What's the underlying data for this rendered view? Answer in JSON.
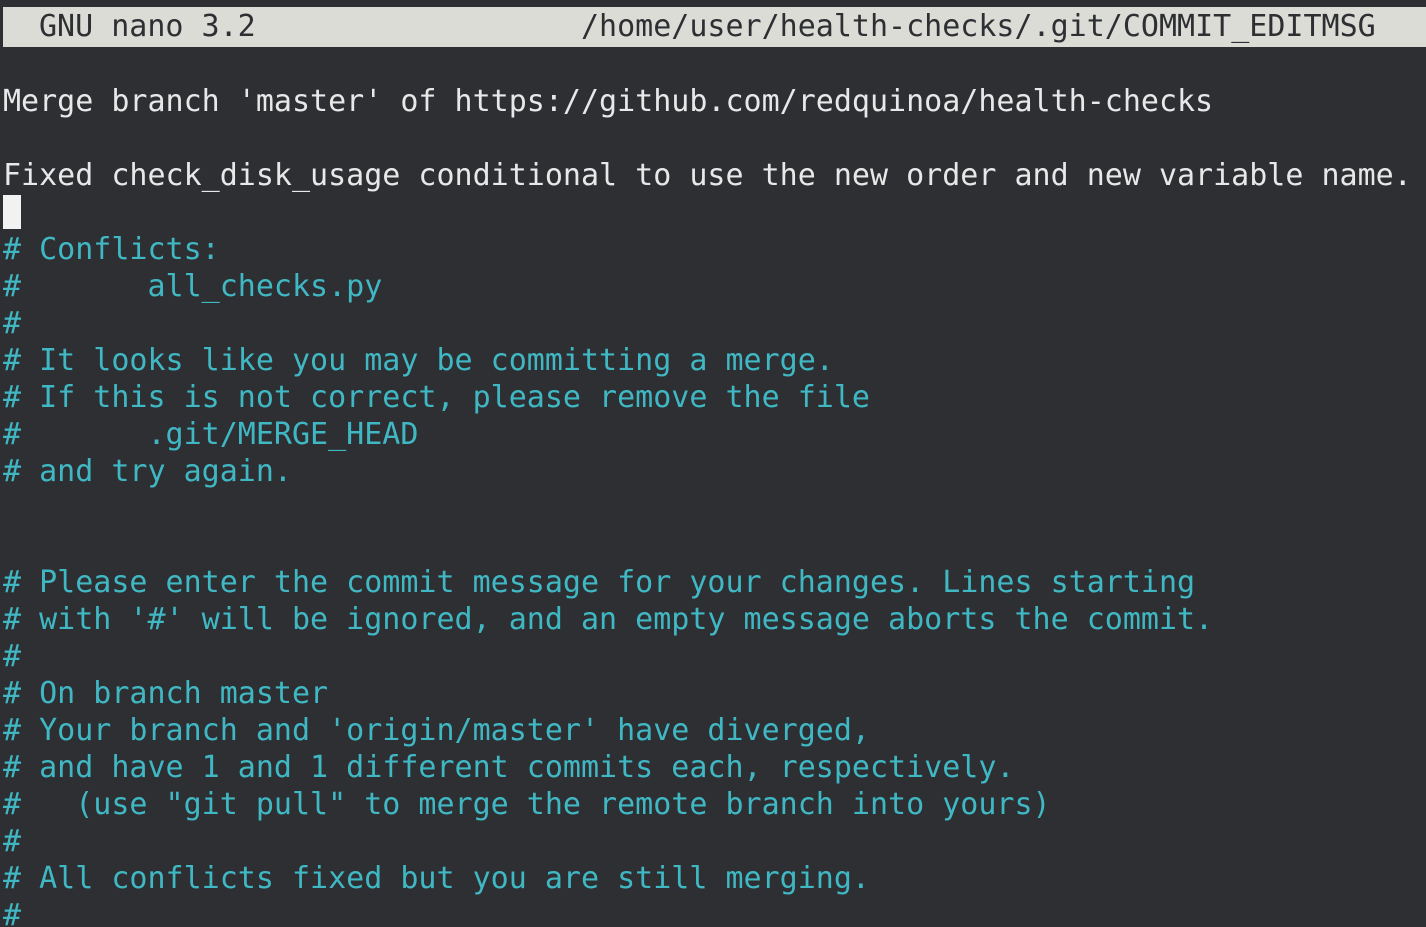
{
  "editor": {
    "name": "GNU nano 3.2",
    "file_path": "/home/user/health-checks/.git/COMMIT_EDITMSG"
  },
  "lines": [
    {
      "text": "Merge branch 'master' of https://github.com/redquinoa/health-checks",
      "kind": "plain"
    },
    {
      "text": "Fixed check_disk_usage conditional to use the new order and new variable name.",
      "kind": "plain"
    },
    {
      "text": "# Conflicts:",
      "kind": "comment"
    },
    {
      "text": "#       all_checks.py",
      "kind": "comment"
    },
    {
      "text": "#",
      "kind": "comment"
    },
    {
      "text": "# It looks like you may be committing a merge.",
      "kind": "comment"
    },
    {
      "text": "# If this is not correct, please remove the file",
      "kind": "comment"
    },
    {
      "text": "#       .git/MERGE_HEAD",
      "kind": "comment"
    },
    {
      "text": "# and try again.",
      "kind": "comment"
    },
    {
      "text": "# Please enter the commit message for your changes. Lines starting",
      "kind": "comment"
    },
    {
      "text": "# with '#' will be ignored, and an empty message aborts the commit.",
      "kind": "comment"
    },
    {
      "text": "#",
      "kind": "comment"
    },
    {
      "text": "# On branch master",
      "kind": "comment"
    },
    {
      "text": "# Your branch and 'origin/master' have diverged,",
      "kind": "comment"
    },
    {
      "text": "# and have 1 and 1 different commits each, respectively.",
      "kind": "comment"
    },
    {
      "text": "#   (use \"git pull\" to merge the remote branch into yours)",
      "kind": "comment"
    },
    {
      "text": "#",
      "kind": "comment"
    },
    {
      "text": "# All conflicts fixed but you are still merging.",
      "kind": "comment"
    },
    {
      "text": "#",
      "kind": "comment"
    }
  ],
  "colors": {
    "background": "#2d2f33",
    "titlebar": "#dcdcd6",
    "text": "#e8e8e8",
    "comment": "#40b8c4"
  }
}
